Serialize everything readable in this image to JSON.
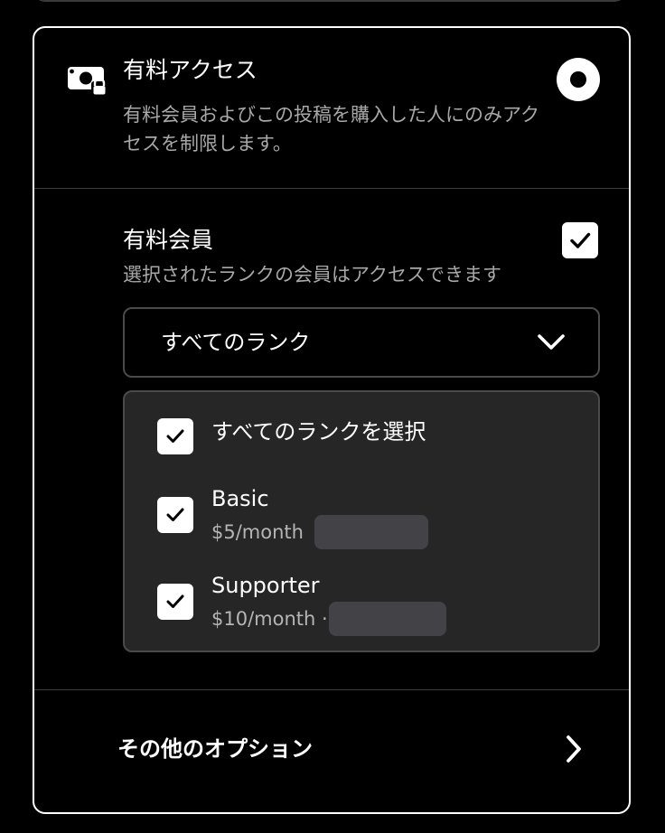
{
  "paid_access": {
    "icon": "money-lock-icon",
    "title": "有料アクセス",
    "description": "有料会員およびこの投稿を購入した人にのみアクセスを制限します。",
    "selected": true
  },
  "paid_members": {
    "title": "有料会員",
    "description": "選択されたランクの会員はアクセスできます",
    "checked": true,
    "dropdown": {
      "selected_value": "すべてのランク",
      "icon": "chevron-down-icon"
    },
    "options": {
      "select_all": {
        "label": "すべてのランクを選択",
        "checked": true
      },
      "ranks": [
        {
          "name": "Basic",
          "price": "$5/month",
          "checked": true
        },
        {
          "name": "Supporter",
          "price": "$10/month ·",
          "checked": true
        }
      ]
    }
  },
  "more_options": {
    "label": "その他のオプション",
    "icon": "chevron-right-icon"
  },
  "colors": {
    "background": "#000000",
    "card_border": "#ffffff",
    "panel": "#262626",
    "muted_text": "#a8a8a8",
    "redacted": "#434347"
  }
}
